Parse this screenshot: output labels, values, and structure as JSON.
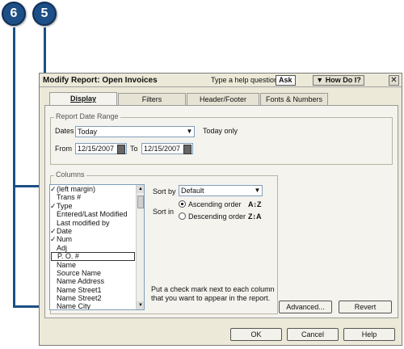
{
  "callouts": [
    "6",
    "5"
  ],
  "dialog": {
    "title": "Modify Report: Open Invoices",
    "help_prompt": "Type a help question",
    "ask_label": "Ask",
    "how_do_i_label": "How Do I?",
    "close_glyph": "✕"
  },
  "tabs": [
    {
      "label": "Display",
      "active": true
    },
    {
      "label": "Filters",
      "active": false
    },
    {
      "label": "Header/Footer",
      "active": false
    },
    {
      "label": "Fonts & Numbers",
      "active": false
    }
  ],
  "date_range": {
    "legend": "Report Date Range",
    "dates_label": "Dates",
    "dates_value": "Today",
    "dates_note": "Today only",
    "from_label": "From",
    "from_value": "12/15/2007",
    "to_label": "To",
    "to_value": "12/15/2007"
  },
  "columns": {
    "legend": "Columns",
    "items": [
      {
        "check": "✓",
        "label": "(left margin)"
      },
      {
        "check": "",
        "label": "Trans #"
      },
      {
        "check": "✓",
        "label": "Type"
      },
      {
        "check": "",
        "label": "Entered/Last Modified"
      },
      {
        "check": "",
        "label": "Last modified by"
      },
      {
        "check": "✓",
        "label": "Date"
      },
      {
        "check": "✓",
        "label": "Num"
      },
      {
        "check": "",
        "label": "Adj"
      },
      {
        "check": "",
        "label": "P. O. #"
      },
      {
        "check": "",
        "label": "Name"
      },
      {
        "check": "",
        "label": "Source Name"
      },
      {
        "check": "",
        "label": "Name Address"
      },
      {
        "check": "",
        "label": "Name Street1"
      },
      {
        "check": "",
        "label": "Name Street2"
      },
      {
        "check": "",
        "label": "Name City"
      }
    ],
    "sort_by_label": "Sort by",
    "sort_by_value": "Default",
    "sort_in_label": "Sort in",
    "ascending_label": "Ascending order",
    "descending_label": "Descending order",
    "ascending_icon": "A↕Z",
    "descending_icon": "Z↕A",
    "hint_line1": "Put a check mark next to each column",
    "hint_line2": "that you want to appear in the report."
  },
  "buttons": {
    "advanced": "Advanced...",
    "revert": "Revert",
    "ok": "OK",
    "cancel": "Cancel",
    "help": "Help"
  },
  "colors": {
    "callout": "#1d4f86",
    "dialog_bg": "#ece9d8"
  }
}
